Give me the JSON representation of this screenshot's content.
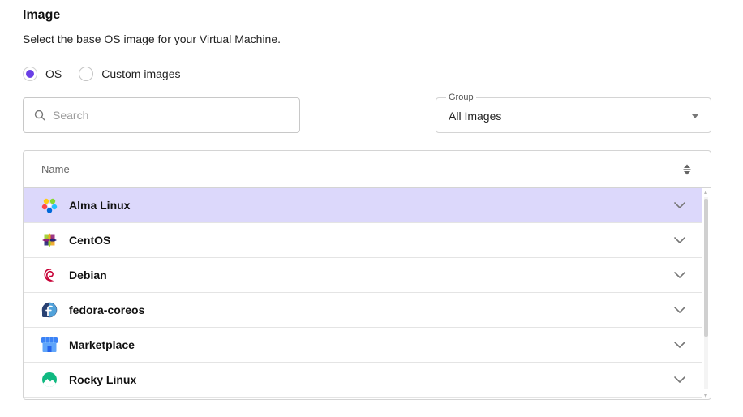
{
  "header": {
    "title": "Image",
    "subtitle": "Select the base OS image for your Virtual Machine."
  },
  "image_source": {
    "options": [
      {
        "label": "OS",
        "checked": true
      },
      {
        "label": "Custom images",
        "checked": false
      }
    ]
  },
  "search": {
    "placeholder": "Search",
    "value": "",
    "icon": "search-icon"
  },
  "group_select": {
    "label": "Group",
    "value": "All Images",
    "icon": "caret-down-icon"
  },
  "table": {
    "column_header": "Name",
    "sort_icon": "sort-icon",
    "rows": [
      {
        "label": "Alma Linux",
        "icon": "alma-linux-logo-icon",
        "selected": true
      },
      {
        "label": "CentOS",
        "icon": "centos-logo-icon",
        "selected": false
      },
      {
        "label": "Debian",
        "icon": "debian-logo-icon",
        "selected": false
      },
      {
        "label": "fedora-coreos",
        "icon": "fedora-logo-icon",
        "selected": false
      },
      {
        "label": "Marketplace",
        "icon": "marketplace-store-icon",
        "selected": false
      },
      {
        "label": "Rocky Linux",
        "icon": "rocky-linux-logo-icon",
        "selected": false
      }
    ]
  },
  "colors": {
    "accent": "#6a3fe6",
    "selected_row": "#dcd8fb",
    "border": "#d4d4d4"
  }
}
